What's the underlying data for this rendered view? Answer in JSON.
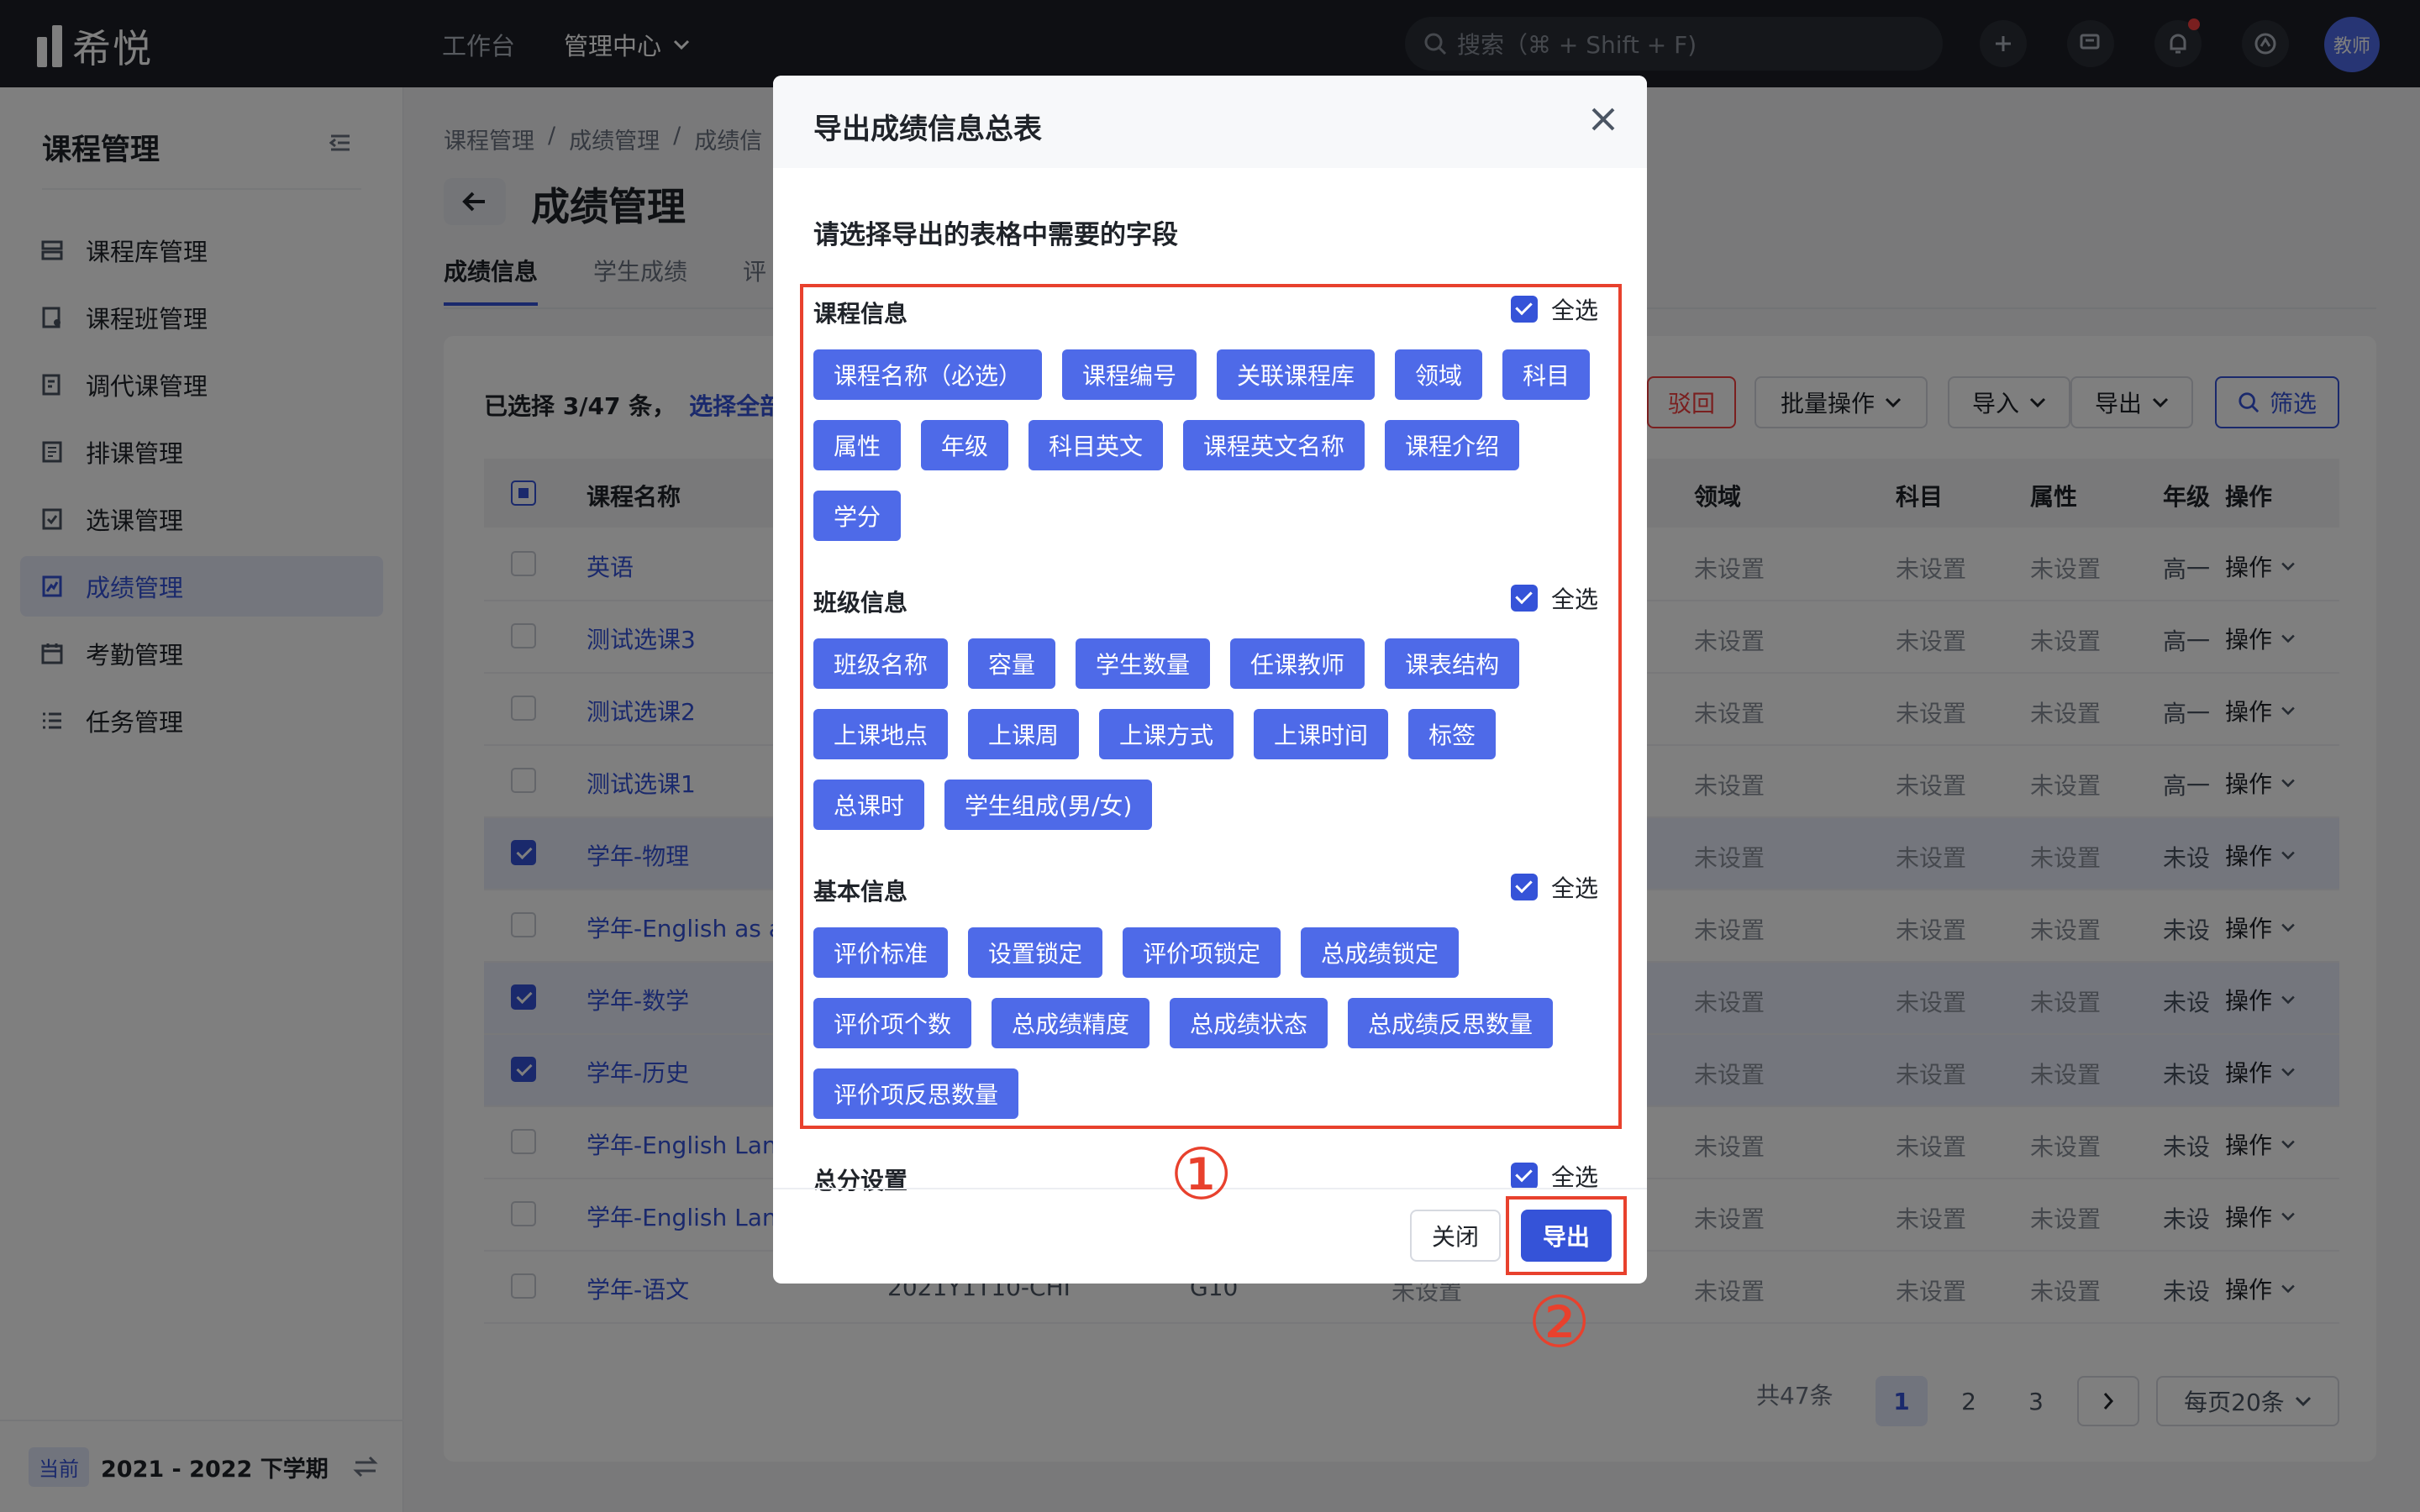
{
  "app": {
    "name": "希悦"
  },
  "topbar": {
    "nav": [
      "工作台",
      "管理中心"
    ],
    "search_placeholder": "搜索（⌘ + Shift + F)",
    "avatar": "教师"
  },
  "sidebar": {
    "title": "课程管理",
    "items": [
      {
        "label": "课程库管理",
        "icon": "list-icon"
      },
      {
        "label": "课程班管理",
        "icon": "class-icon"
      },
      {
        "label": "调代课管理",
        "icon": "swap-doc-icon"
      },
      {
        "label": "排课管理",
        "icon": "schedule-icon"
      },
      {
        "label": "选课管理",
        "icon": "checklist-icon"
      },
      {
        "label": "成绩管理",
        "icon": "grade-icon",
        "active": true
      },
      {
        "label": "考勤管理",
        "icon": "calendar-icon"
      },
      {
        "label": "任务管理",
        "icon": "task-icon"
      }
    ],
    "current_tag": "当前",
    "term": "2021 - 2022 下学期"
  },
  "page": {
    "breadcrumb": [
      "课程管理",
      "/",
      "成绩管理",
      "/",
      "成绩信"
    ],
    "title": "成绩管理",
    "tabs": [
      "成绩信息",
      "学生成绩",
      "评"
    ]
  },
  "toolbar": {
    "selected_text": "已选择 3/47 条，",
    "select_all_link": "选择全部，",
    "reject": "驳回",
    "batch": "批量操作",
    "import": "导入",
    "export": "导出",
    "filter": "筛选"
  },
  "table": {
    "headers": [
      "课程名称",
      "领域",
      "科目",
      "属性",
      "年级",
      "操作"
    ],
    "rows": [
      {
        "name": "英语",
        "domain": "未设置",
        "subject": "未设置",
        "attr": "未设置",
        "grade": "高一",
        "op": "操作",
        "checked": false
      },
      {
        "name": "测试选课3",
        "domain": "未设置",
        "subject": "未设置",
        "attr": "未设置",
        "grade": "高一",
        "op": "操作",
        "checked": false
      },
      {
        "name": "测试选课2",
        "domain": "未设置",
        "subject": "未设置",
        "attr": "未设置",
        "grade": "高一",
        "op": "操作",
        "checked": false
      },
      {
        "name": "测试选课1",
        "domain": "未设置",
        "subject": "未设置",
        "attr": "未设置",
        "grade": "高一",
        "op": "操作",
        "checked": false
      },
      {
        "name": "学年-物理",
        "domain": "未设置",
        "subject": "未设置",
        "attr": "未设置",
        "grade": "未设",
        "op": "操作",
        "checked": true
      },
      {
        "name": "学年-English as a",
        "domain": "未设置",
        "subject": "未设置",
        "attr": "未设置",
        "grade": "未设",
        "op": "操作",
        "checked": false
      },
      {
        "name": "学年-数学",
        "domain": "未设置",
        "subject": "未设置",
        "attr": "未设置",
        "grade": "未设",
        "op": "操作",
        "checked": true
      },
      {
        "name": "学年-历史",
        "domain": "未设置",
        "subject": "未设置",
        "attr": "未设置",
        "grade": "未设",
        "op": "操作",
        "checked": true
      },
      {
        "name": "学年-English Lang",
        "domain": "未设置",
        "subject": "未设置",
        "attr": "未设置",
        "grade": "未设",
        "op": "操作",
        "checked": false
      },
      {
        "name": "学年-English Lang",
        "domain": "未设置",
        "subject": "未设置",
        "attr": "未设置",
        "grade": "未设",
        "op": "操作",
        "checked": false
      },
      {
        "name": "学年-语文",
        "code": "2021Y1T10-CHI",
        "g": "G10",
        "extra": "未设置",
        "domain": "未设置",
        "subject": "未设置",
        "attr": "未设置",
        "grade": "未设",
        "op": "操作",
        "checked": false
      }
    ]
  },
  "pagination": {
    "total": "共47条",
    "pages": [
      "1",
      "2",
      "3"
    ],
    "per_page": "每页20条"
  },
  "modal": {
    "title": "导出成绩信息总表",
    "subtitle": "请选择导出的表格中需要的字段",
    "select_all": "全选",
    "sections": [
      {
        "title": "课程信息",
        "chips": [
          "课程名称（必选）",
          "课程编号",
          "关联课程库",
          "领域",
          "科目",
          "属性",
          "年级",
          "科目英文",
          "课程英文名称",
          "课程介绍",
          "学分"
        ]
      },
      {
        "title": "班级信息",
        "chips": [
          "班级名称",
          "容量",
          "学生数量",
          "任课教师",
          "课表结构",
          "上课地点",
          "上课周",
          "上课方式",
          "上课时间",
          "标签",
          "总课时",
          "学生组成(男/女)"
        ]
      },
      {
        "title": "基本信息",
        "chips": [
          "评价标准",
          "设置锁定",
          "评价项锁定",
          "总成绩锁定",
          "评价项个数",
          "总成绩精度",
          "总成绩状态",
          "总成绩反思数量",
          "评价项反思数量"
        ]
      },
      {
        "title": "总分设置",
        "chips": []
      }
    ],
    "close_btn": "关闭",
    "export_btn": "导出"
  },
  "annotations": {
    "step1": "①",
    "step2": "②",
    "highlight_color": "#e8412d"
  },
  "colors": {
    "accent": "#3553d8",
    "chip": "#4e6ae8",
    "topbar": "#1c1f26"
  }
}
